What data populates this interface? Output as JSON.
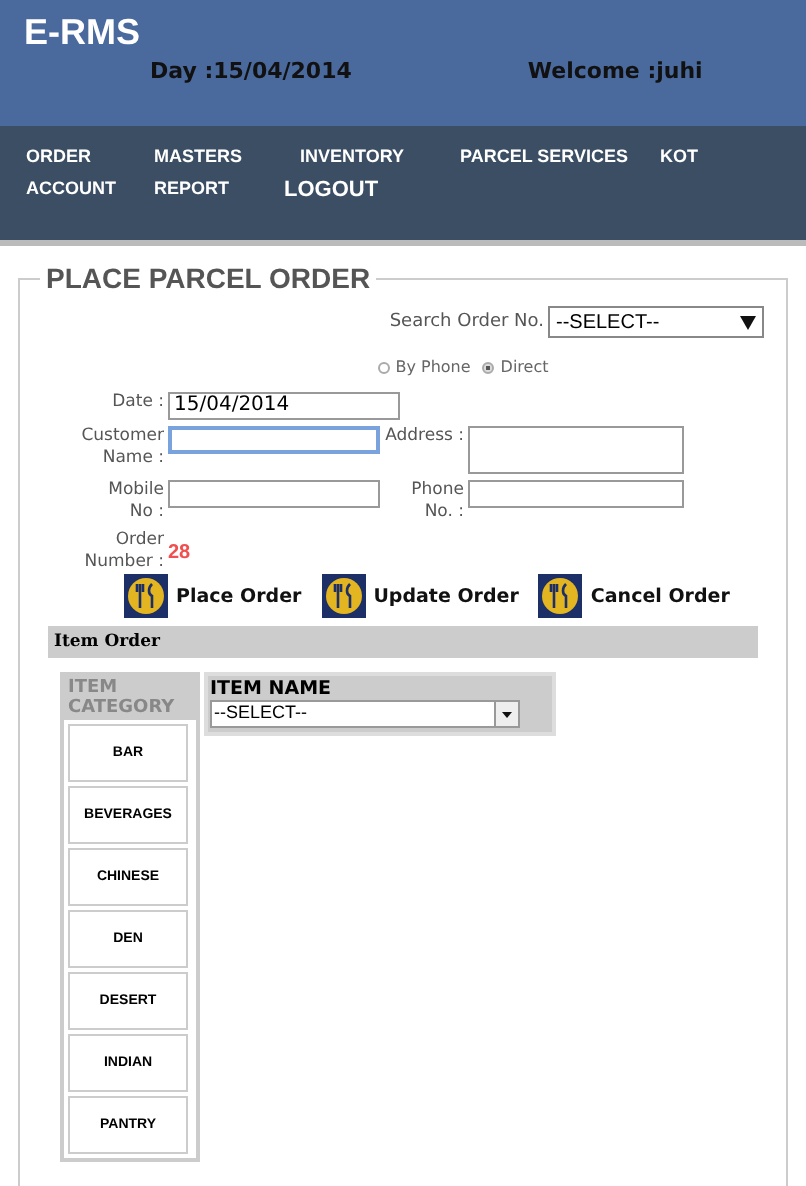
{
  "header": {
    "title": "E-RMS",
    "day": "Day :15/04/2014",
    "welcome": "Welcome :juhi"
  },
  "nav": [
    {
      "label": "ORDER"
    },
    {
      "label": "MASTERS"
    },
    {
      "label": "INVENTORY"
    },
    {
      "label": "PARCEL SERVICES"
    },
    {
      "label": "KOT"
    },
    {
      "label": "ACCOUNT"
    },
    {
      "label": "REPORT"
    },
    {
      "label": "LOGOUT"
    }
  ],
  "section_title": "PLACE PARCEL ORDER",
  "search": {
    "label": "Search Order No.",
    "value": "--SELECT--"
  },
  "order_type": [
    {
      "label": "By Phone",
      "selected": false
    },
    {
      "label": "Direct",
      "selected": true
    }
  ],
  "date": {
    "label": "Date :",
    "value": "15/04/2014"
  },
  "customer_name": {
    "label": "Customer Name :",
    "focused": true
  },
  "address": {
    "label": "Address :"
  },
  "mobile": {
    "label": "Mobile No :"
  },
  "phone": {
    "label": "Phone No. :"
  },
  "order_number": {
    "label": "Order Number :",
    "value": "28"
  },
  "actions": [
    {
      "label": "Place Order"
    },
    {
      "label": "Update Order"
    },
    {
      "label": "Cancel Order"
    }
  ],
  "item_order": {
    "title": "Item Order",
    "category_heading": "ITEM CATEGORY",
    "item_heading": "ITEM NAME",
    "item_select": "--SELECT--",
    "categories": [
      {
        "label": "BAR"
      },
      {
        "label": "BEVERAGES"
      },
      {
        "label": "CHINESE"
      },
      {
        "label": "DEN"
      },
      {
        "label": "DESERT"
      },
      {
        "label": "INDIAN"
      },
      {
        "label": "PANTRY"
      }
    ]
  }
}
